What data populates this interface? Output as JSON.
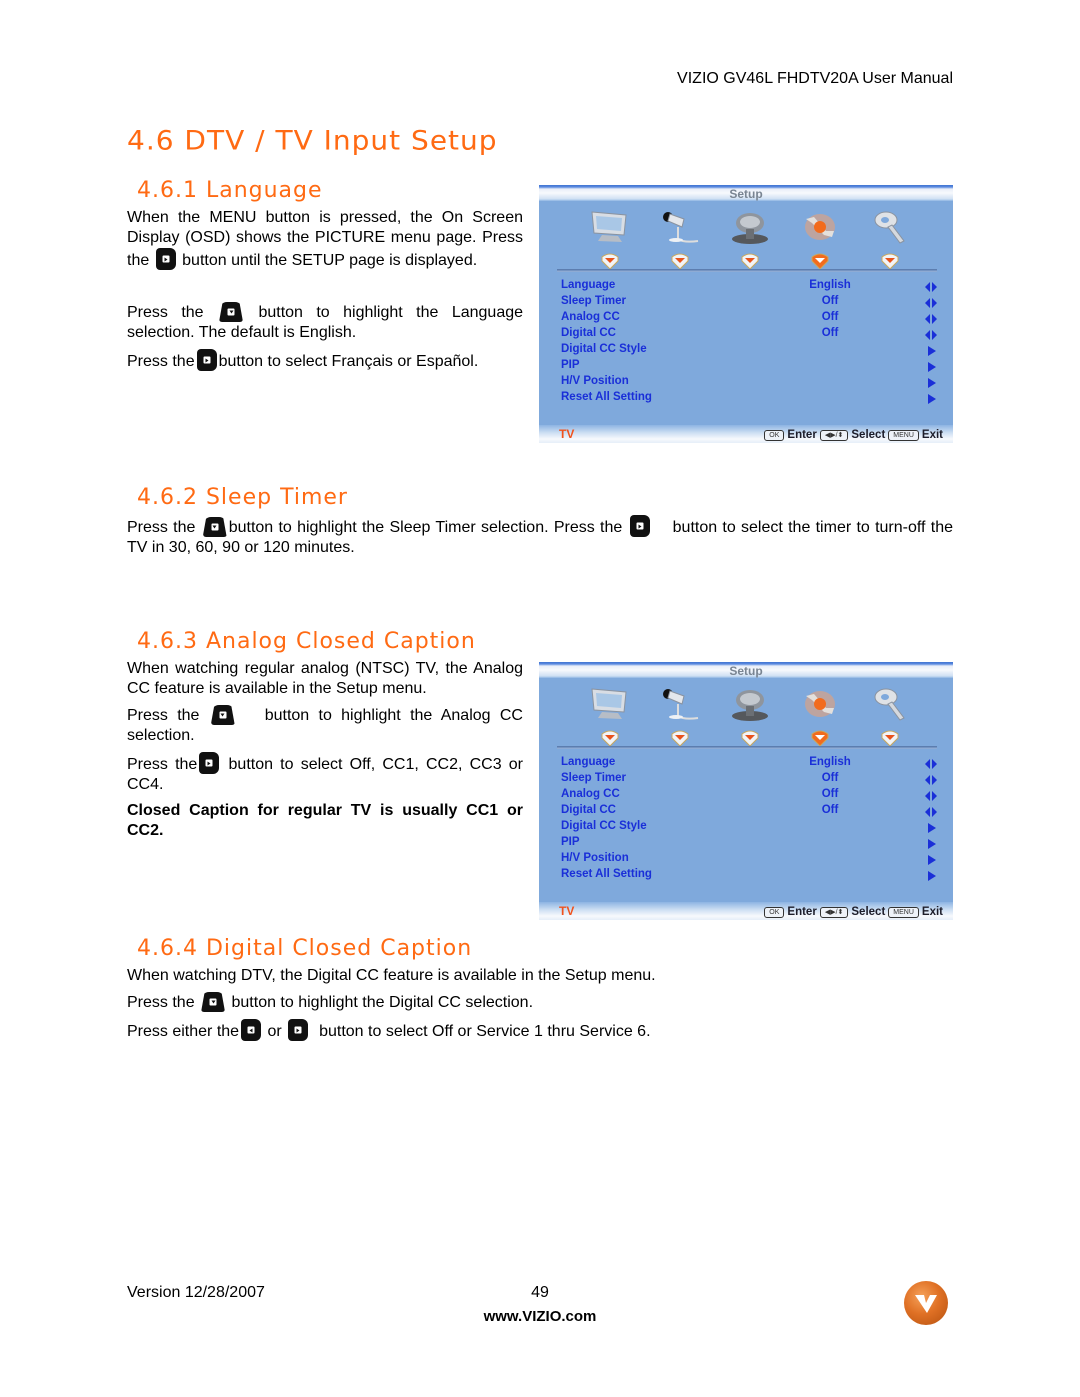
{
  "header": {
    "title": "VIZIO GV46L FHDTV20A User Manual"
  },
  "section": {
    "title": "4.6 DTV / TV Input Setup"
  },
  "subsections": {
    "language": {
      "title": "4.6.1 Language",
      "p1_a": "When the MENU button is pressed, the On Screen Display (OSD) shows the PICTURE menu page. Press the",
      "p1_b": "button until the SETUP page is displayed.",
      "p2_a": "Press the",
      "p2_b": "button to highlight the Language selection.  The default is English.",
      "p3_a": "Press the",
      "p3_b": "button to select Français or Español."
    },
    "sleep_timer": {
      "title": "4.6.2 Sleep Timer",
      "p1_a": "Press the",
      "p1_b": "button to highlight the Sleep Timer selection.  Press the",
      "p1_c": "button to select the timer to turn-off the TV in 30, 60, 90 or 120 minutes."
    },
    "analog_cc": {
      "title": "4.6.3 Analog Closed Caption",
      "p1": "When watching regular analog (NTSC) TV, the Analog CC feature is available in the Setup menu.",
      "p2_a": "Press the",
      "p2_b": "button to highlight the Analog CC selection.",
      "p3_a": "Press the",
      "p3_b": "button to select Off, CC1, CC2, CC3 or CC4.",
      "note": "Closed Caption for regular TV is usually CC1 or CC2."
    },
    "digital_cc": {
      "title": "4.6.4 Digital Closed Caption",
      "p1": "When watching DTV, the Digital CC feature is available in the Setup menu.",
      "p2_a": "Press the",
      "p2_b": "button to highlight the Digital CC selection.",
      "p3_a": "Press either the",
      "p3_mid": "or",
      "p3_b": "button to select Off or Service 1 thru Service 6."
    }
  },
  "osd": {
    "title": "Setup",
    "icons": [
      "picture-icon",
      "audio-microphone-icon",
      "tv-antenna-dish-icon",
      "setup-wrench-icon",
      "parental-key-icon"
    ],
    "active_icon_index": 3,
    "menu": [
      {
        "label": "Language",
        "value": "English",
        "arrow": "left-right"
      },
      {
        "label": "Sleep Timer",
        "value": "Off",
        "arrow": "left-right"
      },
      {
        "label": "Analog CC",
        "value": "Off",
        "arrow": "left-right"
      },
      {
        "label": "Digital CC",
        "value": "Off",
        "arrow": "left-right"
      },
      {
        "label": "Digital CC Style",
        "value": "",
        "arrow": "right"
      },
      {
        "label": "PIP",
        "value": "",
        "arrow": "right"
      },
      {
        "label": "H/V Position",
        "value": "",
        "arrow": "right"
      },
      {
        "label": "Reset All Setting",
        "value": "",
        "arrow": "right"
      }
    ],
    "source": "TV",
    "legend": {
      "ok_key": "OK",
      "enter": "Enter",
      "select": "Select",
      "menu_key": "MENU",
      "exit": "Exit"
    }
  },
  "footer": {
    "version": "Version 12/28/2007",
    "page": "49",
    "url": "www.VIZIO.com"
  },
  "colors": {
    "heading": "#ff6a13",
    "osd_bg": "#7fa9dc",
    "osd_text": "#1a2fd8",
    "osd_source": "#f0521d"
  }
}
